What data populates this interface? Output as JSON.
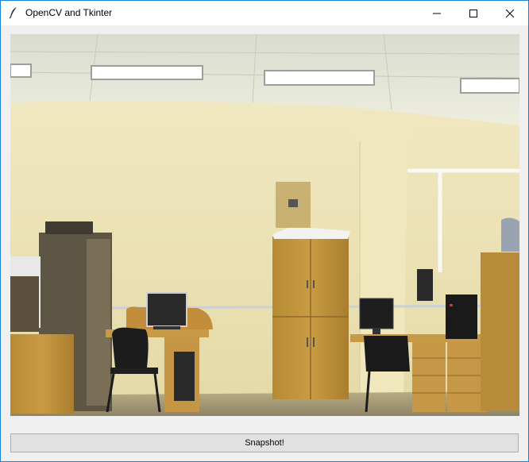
{
  "window": {
    "title": "OpenCV and Tkinter",
    "icon": "feather-icon",
    "controls": [
      "minimize-icon",
      "maximize-icon",
      "close-icon"
    ],
    "border_color": "#1883d7"
  },
  "video": {
    "description_icon": "camera-frame",
    "scene": "office room with cabinets, desks and computers"
  },
  "actions": {
    "snapshot_label": "Snapshot!"
  }
}
